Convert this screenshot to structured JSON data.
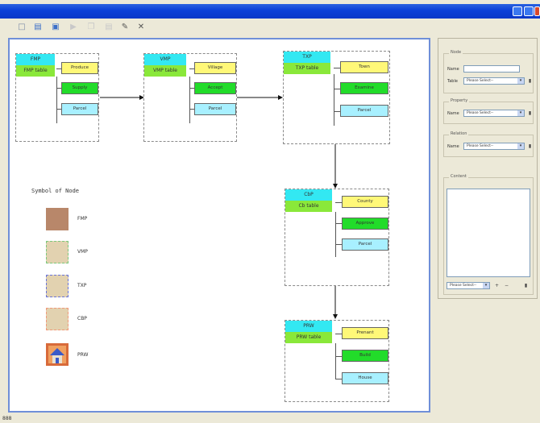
{
  "titlebar": {
    "buttons": [
      "minimize",
      "maximize",
      "close"
    ]
  },
  "toolbar": {
    "icons": [
      "new-file-icon",
      "open-folder-icon",
      "save-icon",
      "run-icon",
      "copy-icon",
      "print-icon",
      "edit-pen-icon",
      "delete-x-icon"
    ]
  },
  "nodes": [
    {
      "id": "fmp",
      "header": "FMP",
      "table": "FMP table",
      "chips": [
        "Produce",
        "Supply",
        "Parcel"
      ]
    },
    {
      "id": "vmp",
      "header": "VMP",
      "table": "VMP table",
      "chips": [
        "Village",
        "Accept",
        "Parcel"
      ]
    },
    {
      "id": "txp",
      "header": "TXP",
      "table": "TXP table",
      "chips": [
        "Town",
        "Examine",
        "Parcel"
      ]
    },
    {
      "id": "cbp",
      "header": "CbP",
      "table": "Cb table",
      "chips": [
        "County",
        "Approve",
        "Parcel"
      ]
    },
    {
      "id": "prw",
      "header": "PRW",
      "table": "PRW table",
      "chips": [
        "Prenant",
        "Build",
        "House"
      ]
    }
  ],
  "legend": {
    "title": "Symbol of Node",
    "items": [
      {
        "label": "FMP",
        "fill": "#b8876a",
        "border": "#b8876a"
      },
      {
        "label": "VMP",
        "fill": "#e2d2b0",
        "border": "#7cc87c"
      },
      {
        "label": "TXP",
        "fill": "#e2d2b0",
        "border": "#6a74d8"
      },
      {
        "label": "CBP",
        "fill": "#e2d2b0",
        "border": "#f09a7a"
      },
      {
        "label": "PRW",
        "fill": "#c8623a",
        "border": "#c8623a"
      }
    ]
  },
  "panel": {
    "node_group": {
      "title": "Node",
      "name_label": "Name",
      "table_label": "Table",
      "table_select": "Please Select--"
    },
    "property_group": {
      "title": "Property",
      "name_label": "Name",
      "name_select": "Please Select--"
    },
    "relation_group": {
      "title": "Relation",
      "name_label": "Name",
      "name_select": "Please Select--"
    },
    "content_group": {
      "title": "Content",
      "select": "Please Select--"
    }
  },
  "status": {
    "text": "888"
  },
  "colors": {
    "header": "#33e8f2",
    "table": "#8ae83a",
    "chip_yellow": "#fff878",
    "chip_green": "#22dc2a",
    "chip_cyan": "#a8f0ff",
    "canvas_border": "#6f8fd8"
  }
}
